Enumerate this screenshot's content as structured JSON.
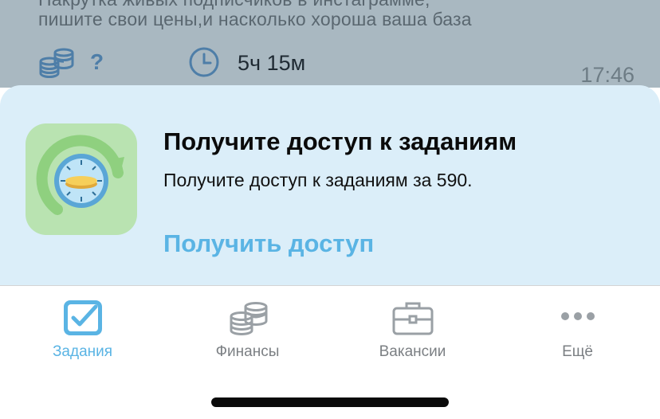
{
  "background_card": {
    "text_line1": "Накрутка живых подписчиков в инстаграмме,",
    "text_line2": "пишите свои цены,и насколько хороша ваша база",
    "price": "?",
    "duration": "5ч 15м",
    "time": "17:46",
    "icons": [
      "coins-stack-icon",
      "clock-icon"
    ]
  },
  "promo": {
    "title": "Получите доступ к заданиям",
    "description": "Получите доступ к заданиям за 590.",
    "cta": "Получить доступ",
    "icon": "clock-refresh-icon"
  },
  "tabbar": {
    "tabs": [
      {
        "label": "Задания",
        "icon": "checkbox-icon",
        "active": true
      },
      {
        "label": "Финансы",
        "icon": "coins-stack-icon",
        "active": false
      },
      {
        "label": "Вакансии",
        "icon": "briefcase-icon",
        "active": false
      },
      {
        "label": "Ещё",
        "icon": "more-dots-icon",
        "active": false
      }
    ]
  },
  "colors": {
    "accent": "#5ab4e4",
    "sheet_bg": "#dbeef9",
    "inactive": "#7b7f83"
  }
}
